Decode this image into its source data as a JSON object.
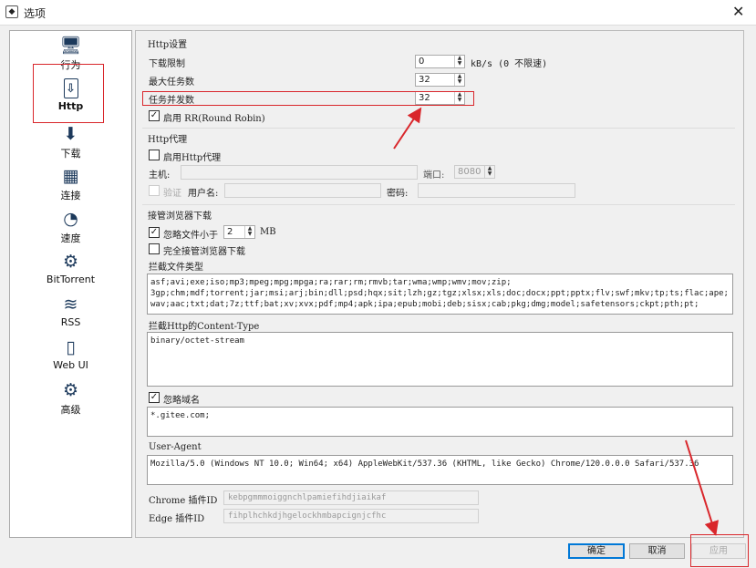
{
  "window": {
    "title": "选项",
    "close": "✕"
  },
  "sidebar": {
    "items": [
      {
        "label": "行为",
        "icon": "🖥"
      },
      {
        "label": "Http",
        "icon": "⇩"
      },
      {
        "label": "下载",
        "icon": "⬇"
      },
      {
        "label": "连接",
        "icon": "▦"
      },
      {
        "label": "速度",
        "icon": "◔"
      },
      {
        "label": "BitTorrent",
        "icon": "⚙"
      },
      {
        "label": "RSS",
        "icon": "≋"
      },
      {
        "label": "Web UI",
        "icon": "▯"
      },
      {
        "label": "高级",
        "icon": "⚙"
      }
    ],
    "selected": "Http"
  },
  "http": {
    "group": "Http设置",
    "speed_limit_label": "下载限制",
    "speed_limit": "0",
    "speed_unit": "kB/s (0 不限速)",
    "max_tasks_label": "最大任务数",
    "max_tasks": "32",
    "concurrency_label": "任务并发数",
    "concurrency": "32",
    "rr_label": "启用 RR(Round Robin)",
    "rr_checked": true
  },
  "proxy": {
    "group": "Http代理",
    "enable_label": "启用Http代理",
    "host_label": "主机:",
    "port_label": "端口:",
    "port": "8080",
    "auth_label": "验证",
    "user_label": "用户名:",
    "password_label": "密码:"
  },
  "browser": {
    "group": "接管浏览器下载",
    "ignore_small_label": "忽略文件小于",
    "ignore_small_value": "2",
    "ignore_small_unit": "MB",
    "full_takeover_label": "完全接管浏览器下载",
    "filetypes_label": "拦截文件类型",
    "filetypes": "asf;avi;exe;iso;mp3;mpeg;mpg;mpga;ra;rar;rm;rmvb;tar;wma;wmp;wmv;mov;zip;\n3gp;chm;mdf;torrent;jar;msi;arj;bin;dll;psd;hqx;sit;lzh;gz;tgz;xlsx;xls;doc;docx;ppt;pptx;flv;swf;mkv;tp;ts;flac;ape;wav;aac;txt;dat;7z;ttf;bat;xv;xvx;pdf;mp4;apk;ipa;epub;mobi;deb;sisx;cab;pkg;dmg;model;safetensors;ckpt;pth;pt;",
    "content_type_label": "拦截Http的Content-Type",
    "content_type": "binary/octet-stream",
    "ignore_domain_label": "忽略域名",
    "ignore_domain": "*.gitee.com;",
    "user_agent_label": "User-Agent",
    "user_agent": "Mozilla/5.0 (Windows NT 10.0; Win64; x64) AppleWebKit/537.36 (KHTML, like Gecko) Chrome/120.0.0.0 Safari/537.36",
    "chrome_id_label": "Chrome 插件ID",
    "chrome_id": "kebpgmmmoiggnchlpamiefihdjiaikaf",
    "edge_id_label": "Edge 插件ID",
    "edge_id": "fihplhchkdjhgelockhmbapcignjcfhc"
  },
  "buttons": {
    "ok": "确定",
    "cancel": "取消",
    "apply": "应用"
  },
  "colors": {
    "annotation": "#d9262b",
    "accent": "#0078d7"
  }
}
